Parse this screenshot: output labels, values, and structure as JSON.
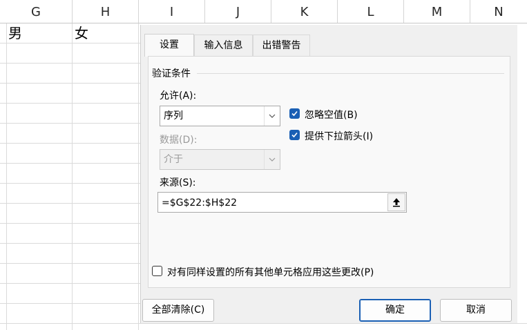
{
  "sheet": {
    "columns": [
      "G",
      "H",
      "I",
      "J",
      "K",
      "L",
      "M",
      "N"
    ],
    "cells": {
      "g22": "男",
      "h22": "女"
    }
  },
  "dialog": {
    "tabs": [
      {
        "label": "设置",
        "active": true
      },
      {
        "label": "输入信息",
        "active": false
      },
      {
        "label": "出错警告",
        "active": false
      }
    ],
    "group_title": "验证条件",
    "allow": {
      "label": "允许(A):",
      "value": "序列"
    },
    "data": {
      "label": "数据(D):",
      "value": "介于"
    },
    "ignore_blank": {
      "label": "忽略空值(B)",
      "checked": true
    },
    "dropdown": {
      "label": "提供下拉箭头(I)",
      "checked": true
    },
    "source": {
      "label": "来源(S):",
      "value": "=$G$22:$H$22"
    },
    "apply_all": {
      "label": "对有同样设置的所有其他单元格应用这些更改(P)",
      "checked": false
    },
    "buttons": {
      "clear_all": "全部清除(C)",
      "ok": "确定",
      "cancel": "取消"
    }
  },
  "colors": {
    "accent": "#1a5fb4",
    "dialog_bg": "#f0f0f0",
    "panel_bg": "#f9f9f9"
  },
  "icons": {
    "combo_arrow": "chevron-down-icon",
    "collapse": "collapse-dialog-icon",
    "check": "checkmark-icon"
  }
}
